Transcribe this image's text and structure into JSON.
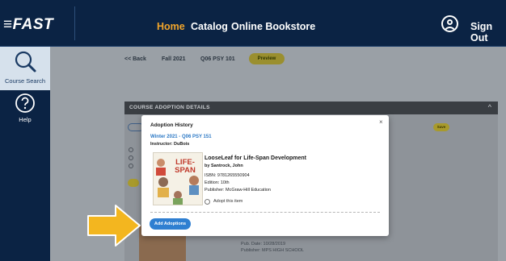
{
  "brand": {
    "logo": "≡FAST"
  },
  "nav": {
    "links": [
      {
        "label": "Home",
        "active": true
      },
      {
        "label": "Catalog",
        "active": false
      },
      {
        "label": "Online Bookstore",
        "active": false
      }
    ],
    "user_icon": "user-circle-icon",
    "sign_out": "Sign Out"
  },
  "sidebar": {
    "items": [
      {
        "label": "Course Search",
        "icon": "search-icon",
        "active": true
      },
      {
        "label": "Help",
        "icon": "help-icon",
        "active": false
      }
    ]
  },
  "breadcrumb": {
    "back": "<< Back",
    "term": "Fall 2021",
    "course": "Q06 PSY 101",
    "preview": "Preview"
  },
  "panel": {
    "title": "COURSE ADOPTION DETAILS",
    "chevron": "^",
    "save": "Save"
  },
  "modal": {
    "title": "Adoption History",
    "close": "×",
    "course": "Winter 2021 - Q06 PSY 151",
    "instructor": "Instructor: DuBois",
    "book": {
      "title": "LooseLeaf for Life-Span Development",
      "author": "by Santrock, John",
      "isbn": "ISBN: 9781265550904",
      "edition": "Edition: 10th",
      "publisher": "Publisher: McGraw-Hill Education",
      "cover_title": "LIFE-SPAN",
      "adopt_label": "Adopt this item"
    },
    "add_button": "Add Adoptions"
  },
  "background_book": {
    "pub_date": "Pub. Date: 10/28/2019",
    "publisher": "Publisher: MPS HIGH SCHOOL"
  },
  "colors": {
    "nav_bg": "#0b2344",
    "active_nav": "#f2a52b",
    "primary_button": "#2f7fd1",
    "arrow": "#f3b61f",
    "link_blue": "#2b78c5"
  }
}
